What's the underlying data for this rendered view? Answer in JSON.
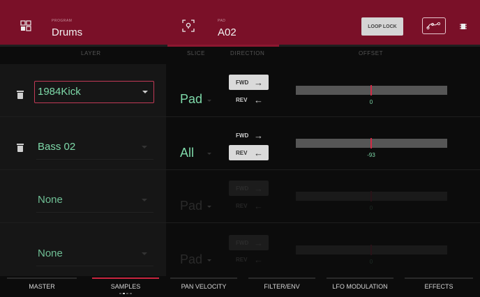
{
  "header": {
    "program_label": "PROGRAM",
    "program_name": "Drums",
    "pad_label": "PAD",
    "pad_name": "A02",
    "loop_lock_label": "LOOP LOCK"
  },
  "columns": {
    "layer": "LAYER",
    "slice": "SLICE",
    "direction": "DIRECTION",
    "offset": "OFFSET"
  },
  "layers": [
    {
      "name": "1984Kick",
      "slice": "Pad",
      "direction": "FWD",
      "fwd_label": "FWD",
      "rev_label": "REV",
      "offset": "0",
      "offset_value": 0
    },
    {
      "name": "Bass 02",
      "slice": "All",
      "direction": "REV",
      "fwd_label": "FWD",
      "rev_label": "REV",
      "offset": "-93",
      "offset_value": -93
    },
    {
      "name": "None",
      "slice": "Pad",
      "direction": "FWD",
      "fwd_label": "FWD",
      "rev_label": "REV",
      "offset": "0",
      "offset_value": 0
    },
    {
      "name": "None",
      "slice": "Pad",
      "direction": "FWD",
      "fwd_label": "FWD",
      "rev_label": "REV",
      "offset": "0",
      "offset_value": 0
    }
  ],
  "tabs": [
    {
      "label": "MASTER",
      "active": false
    },
    {
      "label": "SAMPLES",
      "active": true
    },
    {
      "label": "PAN VELOCITY",
      "active": false
    },
    {
      "label": "FILTER/ENV",
      "active": false
    },
    {
      "label": "LFO MODULATION",
      "active": false
    },
    {
      "label": "EFFECTS",
      "active": false
    }
  ],
  "page_indicator": {
    "count": 4,
    "current": 2
  },
  "colors": {
    "header": "#7a1028",
    "accent": "#c9253f",
    "value": "#7ed9a9"
  },
  "icons": [
    "grid-icon",
    "pad-target-icon",
    "lfo-curve-icon",
    "chip-icon",
    "trash-icon",
    "arrow-right-icon",
    "arrow-left-icon"
  ]
}
